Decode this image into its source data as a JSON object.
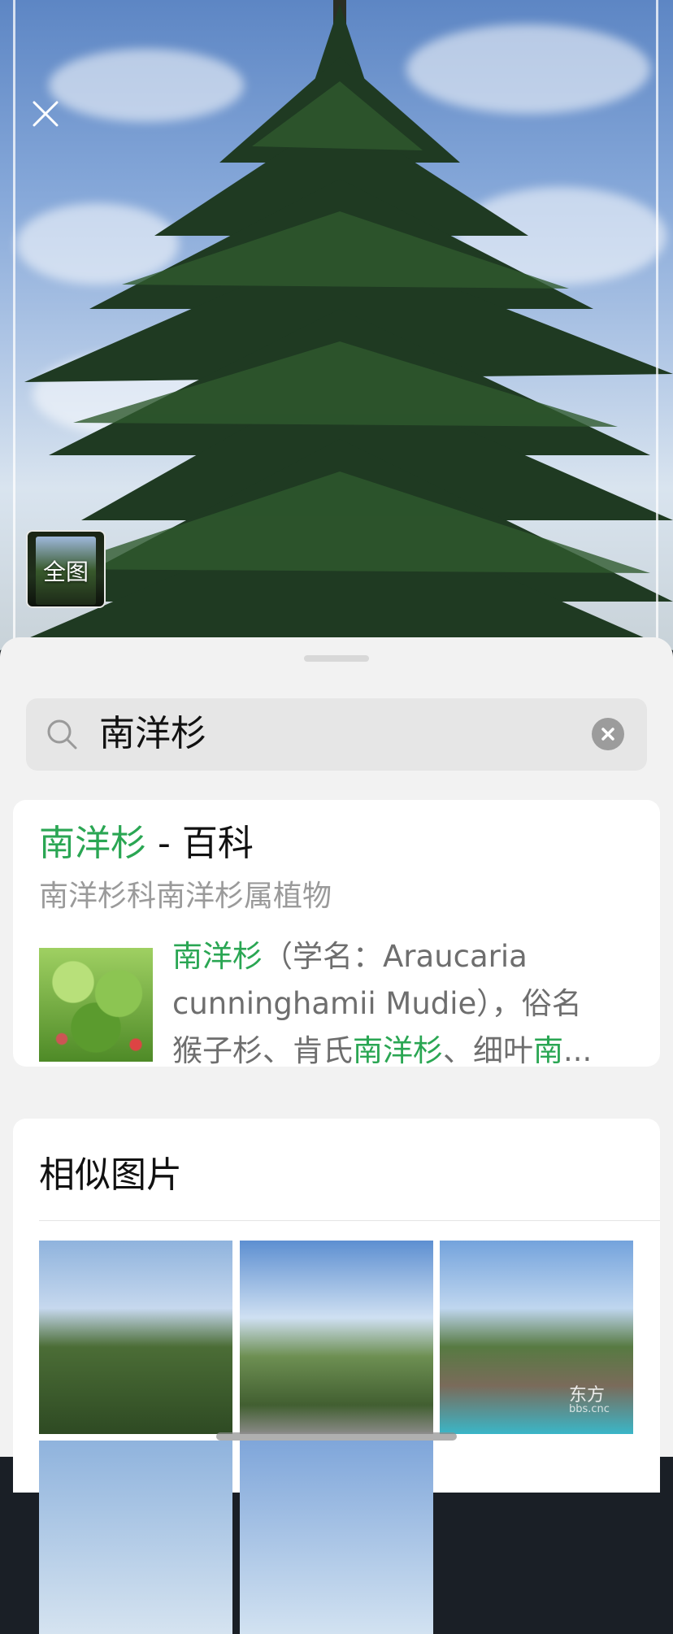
{
  "image_viewer": {
    "close_icon": "close-icon",
    "thumbnail_label": "全图"
  },
  "search": {
    "query": "南洋杉",
    "search_icon": "search-icon",
    "clear_icon": "clear-icon"
  },
  "encyclopedia_card": {
    "title_term": "南洋杉",
    "title_suffix": " - 百科",
    "subtitle": "南洋杉科南洋杉属植物",
    "desc_line1_hl": "南洋杉",
    "desc_line1_rest": "（学名：Araucaria",
    "desc_line2": "cunninghamii Mudie），俗名",
    "desc_line3_a": "猴子杉、肯氏",
    "desc_line3_hl1": "南洋杉",
    "desc_line3_b": "、细叶",
    "desc_line3_hl2": "南",
    "desc_line3_ellipsis": "..."
  },
  "similar_images": {
    "title": "相似图片",
    "watermark": "东方",
    "watermark_url": "bbs.cnc"
  },
  "colors": {
    "accent_green": "#2aa653",
    "sheet_bg": "#f2f2f2"
  }
}
